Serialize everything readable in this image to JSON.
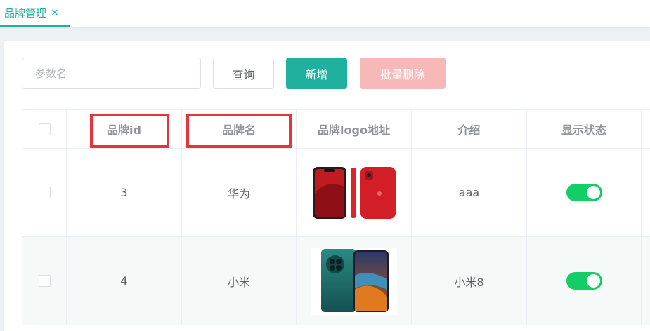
{
  "tabs": [
    {
      "label": "品牌管理",
      "close": "×"
    }
  ],
  "search": {
    "placeholder": "参数名",
    "value": ""
  },
  "toolbar": {
    "query_label": "查询",
    "add_label": "新增",
    "batch_delete_label": "批量删除"
  },
  "table": {
    "headers": [
      "品牌id",
      "品牌名",
      "品牌logo地址",
      "介绍",
      "显示状态"
    ],
    "rows": [
      {
        "id": "3",
        "name": "华为",
        "logo": "red-phone-image",
        "intro": "aaa",
        "status": true
      },
      {
        "id": "4",
        "name": "小米",
        "logo": "green-phone-image",
        "intro": "小米8",
        "status": true
      }
    ]
  },
  "colors": {
    "accent": "#1fb19e",
    "danger_disabled": "#f7b8b8",
    "switch_on": "#13ce66",
    "highlight": "#e8333a"
  }
}
